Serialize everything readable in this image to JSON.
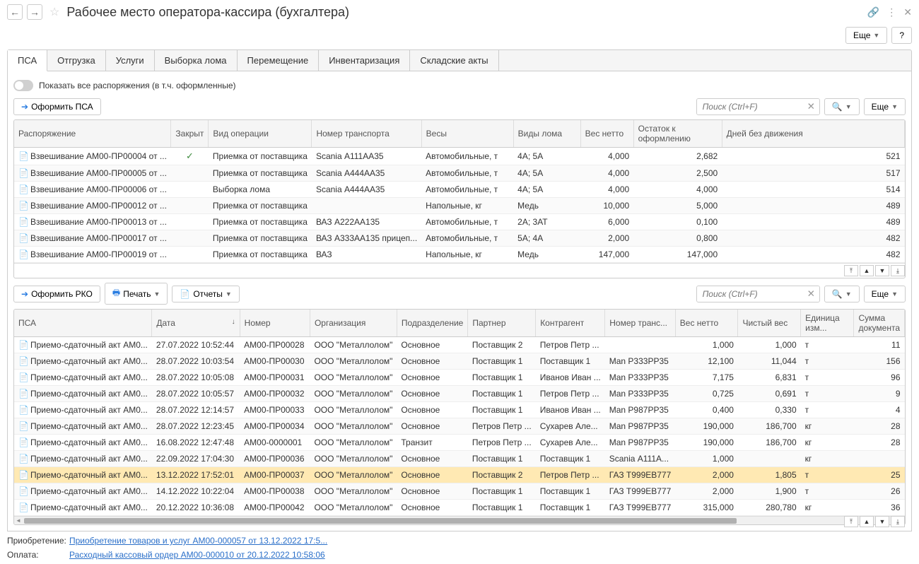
{
  "title": "Рабочее место оператора-кассира (бухгалтера)",
  "more_btn": "Еще",
  "help_btn": "?",
  "tabs": [
    "ПСА",
    "Отгрузка",
    "Услуги",
    "Выборка лома",
    "Перемещение",
    "Инвентаризация",
    "Складские акты"
  ],
  "toggle_label": "Показать все распоряжения (в т.ч. оформленные)",
  "btn_psa": "Оформить ПСА",
  "btn_rko": "Оформить РКО",
  "btn_print": "Печать",
  "btn_reports": "Отчеты",
  "search_ph": "Поиск (Ctrl+F)",
  "top_table": {
    "headers": [
      "Распоряжение",
      "Закрыт",
      "Вид операции",
      "Номер транспорта",
      "Весы",
      "Виды лома",
      "Вес нетто",
      "Остаток к оформлению",
      "Дней без движения"
    ],
    "rows": [
      {
        "doc": "Взвешивание АМ00-ПР00004 от ...",
        "closed": true,
        "op": "Приемка от поставщика",
        "trans": "Scania А111АА35",
        "scale": "Автомобильные, т",
        "scrap": "4А; 5А",
        "net": "4,000",
        "rest": "2,682",
        "days": "521"
      },
      {
        "doc": "Взвешивание АМ00-ПР00005 от ...",
        "closed": false,
        "op": "Приемка от поставщика",
        "trans": "Scania А444АА35",
        "scale": "Автомобильные, т",
        "scrap": "4А; 5А",
        "net": "4,000",
        "rest": "2,500",
        "days": "517"
      },
      {
        "doc": "Взвешивание АМ00-ПР00006 от ...",
        "closed": false,
        "op": "Выборка лома",
        "trans": "Scania А444АА35",
        "scale": "Автомобильные, т",
        "scrap": "4А; 5А",
        "net": "4,000",
        "rest": "4,000",
        "days": "514"
      },
      {
        "doc": "Взвешивание АМ00-ПР00012 от ...",
        "closed": false,
        "op": "Приемка от поставщика",
        "trans": "",
        "scale": "Напольные, кг",
        "scrap": "Медь",
        "net": "10,000",
        "rest": "5,000",
        "days": "489"
      },
      {
        "doc": "Взвешивание АМ00-ПР00013 от ...",
        "closed": false,
        "op": "Приемка от поставщика",
        "trans": "ВАЗ А222АА135",
        "scale": "Автомобильные, т",
        "scrap": "2А; 3АТ",
        "net": "6,000",
        "rest": "0,100",
        "days": "489"
      },
      {
        "doc": "Взвешивание АМ00-ПР00017 от ...",
        "closed": false,
        "op": "Приемка от поставщика",
        "trans": "ВАЗ А333АА135 прицеп...",
        "scale": "Автомобильные, т",
        "scrap": "5А; 4А",
        "net": "2,000",
        "rest": "0,800",
        "days": "482"
      },
      {
        "doc": "Взвешивание АМ00-ПР00019 от ...",
        "closed": false,
        "op": "Приемка от поставщика",
        "trans": "ВАЗ",
        "scale": "Напольные, кг",
        "scrap": "Медь",
        "net": "147,000",
        "rest": "147,000",
        "days": "482"
      }
    ]
  },
  "bottom_table": {
    "headers": [
      "ПСА",
      "Дата",
      "Номер",
      "Организация",
      "Подразделение",
      "Партнер",
      "Контрагент",
      "Номер транс...",
      "Вес нетто",
      "Чистый вес",
      "Единица изм...",
      "Сумма документа"
    ],
    "rows": [
      {
        "psa": "Приемо-сдаточный акт АМ0...",
        "date": "27.07.2022 10:52:44",
        "num": "АМ00-ПР00028",
        "org": "ООО \"Металлолом\"",
        "dep": "Основное",
        "partner": "Поставщик 2",
        "contr": "Петров Петр ...",
        "trans": "",
        "net": "1,000",
        "clean": "1,000",
        "unit": "т",
        "sum": "11"
      },
      {
        "psa": "Приемо-сдаточный акт АМ0...",
        "date": "28.07.2022 10:03:54",
        "num": "АМ00-ПР00030",
        "org": "ООО \"Металлолом\"",
        "dep": "Основное",
        "partner": "Поставщик 1",
        "contr": "Поставщик 1",
        "trans": "Man Р333РР35",
        "net": "12,100",
        "clean": "11,044",
        "unit": "т",
        "sum": "156"
      },
      {
        "psa": "Приемо-сдаточный акт АМ0...",
        "date": "28.07.2022 10:05:08",
        "num": "АМ00-ПР00031",
        "org": "ООО \"Металлолом\"",
        "dep": "Основное",
        "partner": "Поставщик 1",
        "contr": "Иванов Иван ...",
        "trans": "Man Р333РР35",
        "net": "7,175",
        "clean": "6,831",
        "unit": "т",
        "sum": "96"
      },
      {
        "psa": "Приемо-сдаточный акт АМ0...",
        "date": "28.07.2022 10:05:57",
        "num": "АМ00-ПР00032",
        "org": "ООО \"Металлолом\"",
        "dep": "Основное",
        "partner": "Поставщик 1",
        "contr": "Петров Петр ...",
        "trans": "Man Р333РР35",
        "net": "0,725",
        "clean": "0,691",
        "unit": "т",
        "sum": "9"
      },
      {
        "psa": "Приемо-сдаточный акт АМ0...",
        "date": "28.07.2022 12:14:57",
        "num": "АМ00-ПР00033",
        "org": "ООО \"Металлолом\"",
        "dep": "Основное",
        "partner": "Поставщик 1",
        "contr": "Иванов Иван ...",
        "trans": "Man Р987РР35",
        "net": "0,400",
        "clean": "0,330",
        "unit": "т",
        "sum": "4"
      },
      {
        "psa": "Приемо-сдаточный акт АМ0...",
        "date": "28.07.2022 12:23:45",
        "num": "АМ00-ПР00034",
        "org": "ООО \"Металлолом\"",
        "dep": "Основное",
        "partner": "Петров Петр ...",
        "contr": "Сухарев Але...",
        "trans": "Man Р987РР35",
        "net": "190,000",
        "clean": "186,700",
        "unit": "кг",
        "sum": "28"
      },
      {
        "psa": "Приемо-сдаточный акт АМ0...",
        "date": "16.08.2022 12:47:48",
        "num": "АМ00-0000001",
        "org": "ООО \"Металлолом\"",
        "dep": "Транзит",
        "partner": "Петров Петр ...",
        "contr": "Сухарев Але...",
        "trans": "Man Р987РР35",
        "net": "190,000",
        "clean": "186,700",
        "unit": "кг",
        "sum": "28"
      },
      {
        "psa": "Приемо-сдаточный акт АМ0...",
        "date": "22.09.2022 17:04:30",
        "num": "АМ00-ПР00036",
        "org": "ООО \"Металлолом\"",
        "dep": "Основное",
        "partner": "Поставщик 1",
        "contr": "Поставщик 1",
        "trans": "Scania А111А...",
        "net": "1,000",
        "clean": "",
        "unit": "кг",
        "sum": ""
      },
      {
        "psa": "Приемо-сдаточный акт АМ0...",
        "date": "13.12.2022 17:52:01",
        "num": "АМ00-ПР00037",
        "org": "ООО \"Металлолом\"",
        "dep": "Основное",
        "partner": "Поставщик 2",
        "contr": "Петров Петр ...",
        "trans": "ГАЗ Т999ЕВ777",
        "net": "2,000",
        "clean": "1,805",
        "unit": "т",
        "sum": "25",
        "selected": true
      },
      {
        "psa": "Приемо-сдаточный акт АМ0...",
        "date": "14.12.2022 10:22:04",
        "num": "АМ00-ПР00038",
        "org": "ООО \"Металлолом\"",
        "dep": "Основное",
        "partner": "Поставщик 1",
        "contr": "Поставщик 1",
        "trans": "ГАЗ Т999ЕВ777",
        "net": "2,000",
        "clean": "1,900",
        "unit": "т",
        "sum": "26"
      },
      {
        "psa": "Приемо-сдаточный акт АМ0...",
        "date": "20.12.2022 10:36:08",
        "num": "АМ00-ПР00042",
        "org": "ООО \"Металлолом\"",
        "dep": "Основное",
        "partner": "Поставщик 1",
        "contr": "Поставщик 1",
        "trans": "ГАЗ Т999ЕВ777",
        "net": "315,000",
        "clean": "280,780",
        "unit": "кг",
        "sum": "36"
      }
    ]
  },
  "footer": {
    "acq_label": "Приобретение:",
    "acq_link": "Приобретение товаров и услуг АМ00-000057 от 13.12.2022 17:5...",
    "pay_label": "Оплата:",
    "pay_link": "Расходный кассовый ордер АМ00-000010 от 20.12.2022 10:58:06"
  }
}
